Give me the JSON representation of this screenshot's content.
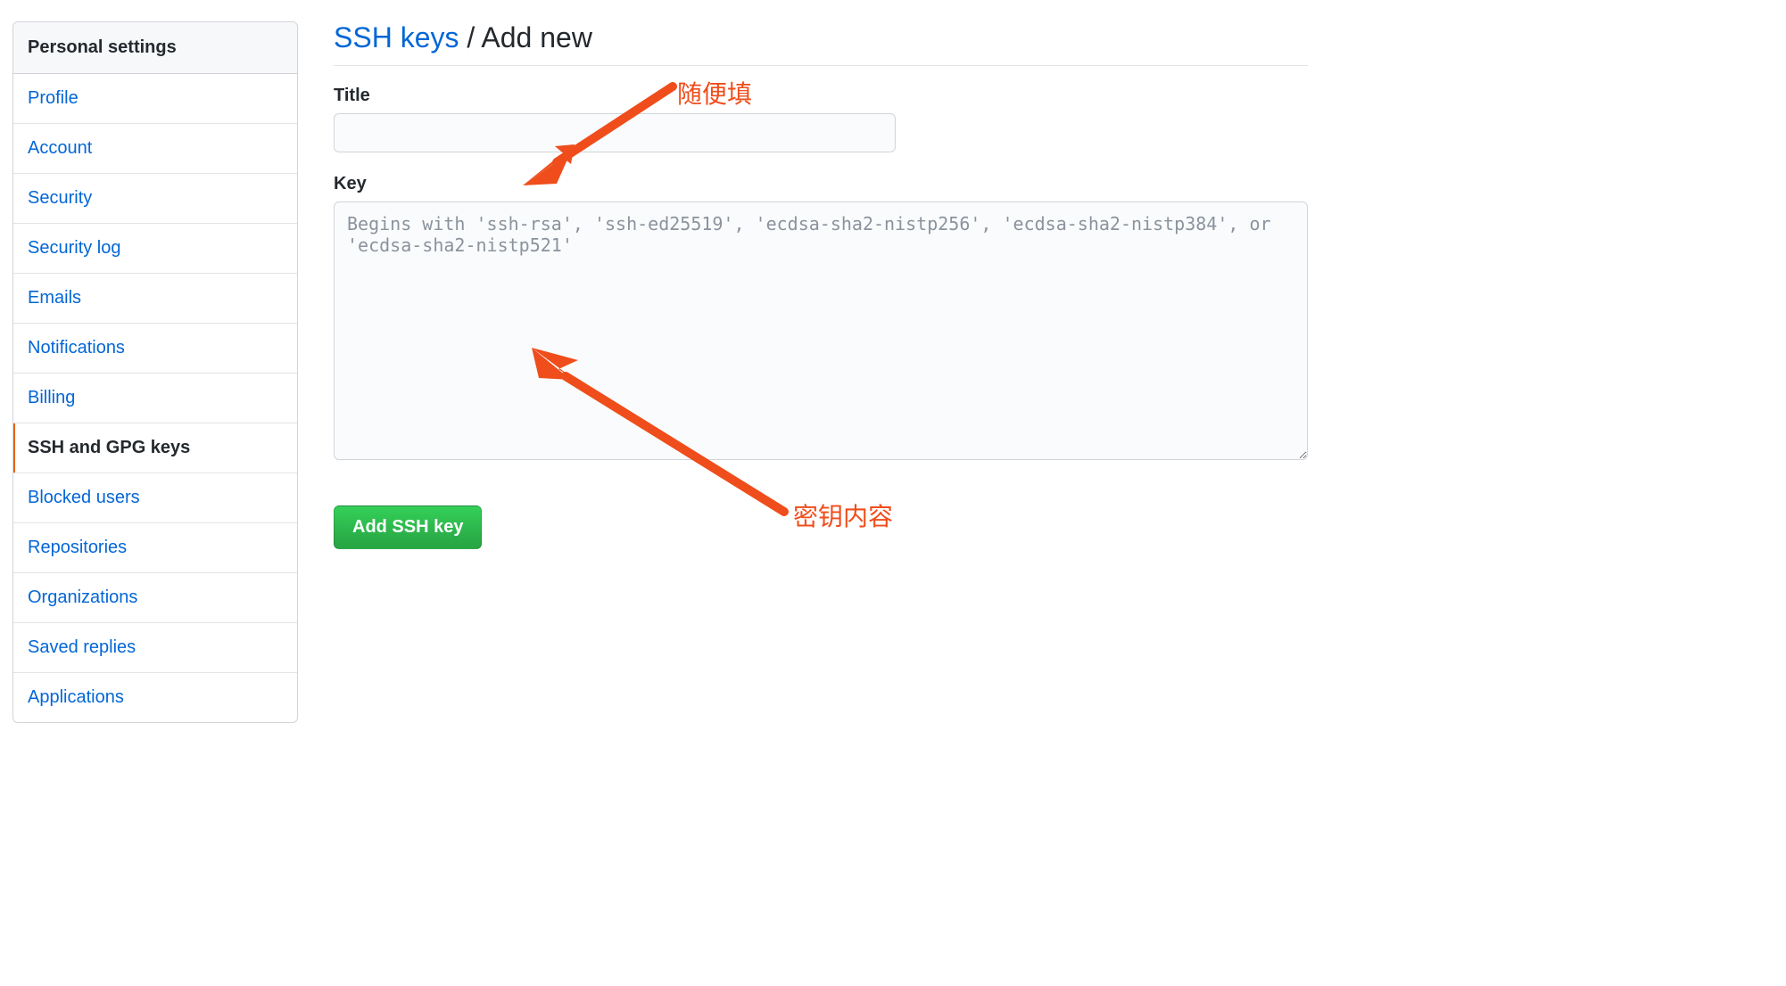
{
  "sidebar": {
    "header": "Personal settings",
    "items": [
      {
        "label": "Profile",
        "active": false
      },
      {
        "label": "Account",
        "active": false
      },
      {
        "label": "Security",
        "active": false
      },
      {
        "label": "Security log",
        "active": false
      },
      {
        "label": "Emails",
        "active": false
      },
      {
        "label": "Notifications",
        "active": false
      },
      {
        "label": "Billing",
        "active": false
      },
      {
        "label": "SSH and GPG keys",
        "active": true
      },
      {
        "label": "Blocked users",
        "active": false
      },
      {
        "label": "Repositories",
        "active": false
      },
      {
        "label": "Organizations",
        "active": false
      },
      {
        "label": "Saved replies",
        "active": false
      },
      {
        "label": "Applications",
        "active": false
      }
    ]
  },
  "main": {
    "title_link": "SSH keys",
    "title_sep": " / ",
    "title_current": "Add new",
    "form": {
      "title_label": "Title",
      "title_value": "",
      "key_label": "Key",
      "key_placeholder": "Begins with 'ssh-rsa', 'ssh-ed25519', 'ecdsa-sha2-nistp256', 'ecdsa-sha2-nistp384', or 'ecdsa-sha2-nistp521'",
      "key_value": "",
      "submit_label": "Add SSH key"
    }
  },
  "annotations": {
    "title_hint": "随便填",
    "key_hint": "密钥内容"
  },
  "colors": {
    "annotation": "#ef4d1b",
    "link": "#0366d6",
    "primary_button": "#28a745",
    "active_indicator": "#e36209"
  }
}
